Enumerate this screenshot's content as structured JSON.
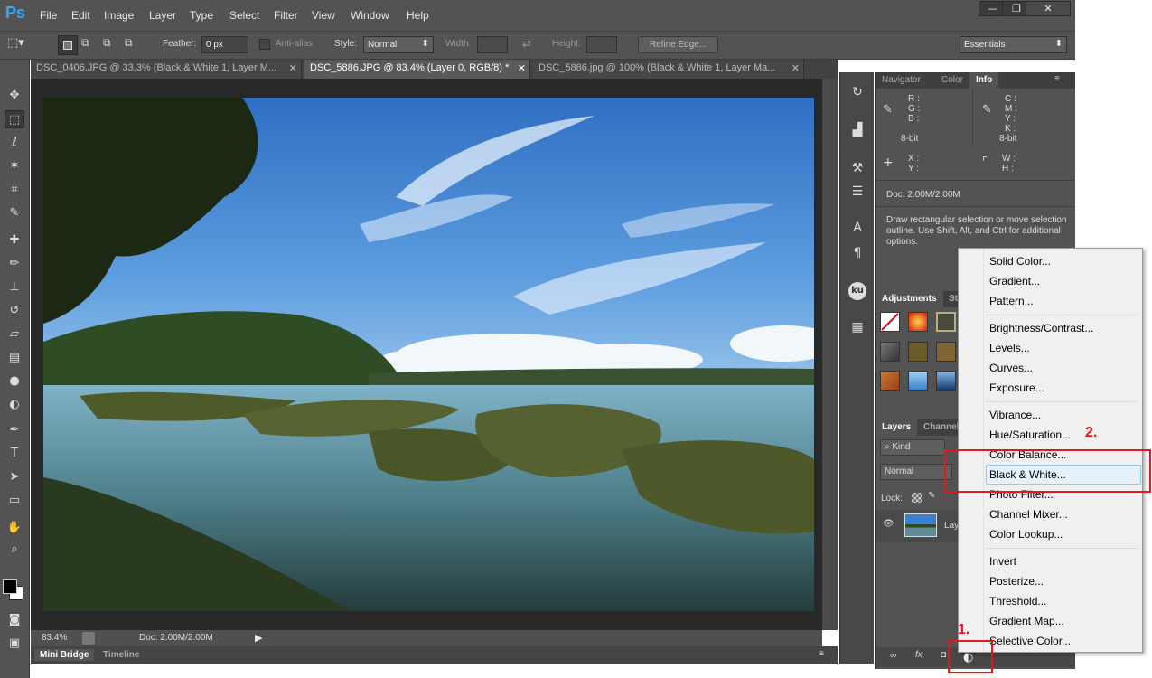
{
  "app": {
    "logo": "Ps"
  },
  "menubar": {
    "items": [
      "File",
      "Edit",
      "Image",
      "Layer",
      "Type",
      "Select",
      "Filter",
      "View",
      "Window",
      "Help"
    ]
  },
  "window_controls": {
    "minimize": "—",
    "restore": "❐",
    "close": "✕"
  },
  "options": {
    "feather_label": "Feather:",
    "feather_value": "0 px",
    "antialias_label": "Anti-alias",
    "style_label": "Style:",
    "style_value": "Normal",
    "width_label": "Width:",
    "height_label": "Height:",
    "refine_edge": "Refine Edge...",
    "workspace": "Essentials"
  },
  "tabs": [
    {
      "label": "DSC_0406.JPG @ 33.3% (Black & White 1, Layer M..."
    },
    {
      "label": "DSC_5886.JPG @ 83.4% (Layer 0, RGB/8) *"
    },
    {
      "label": "DSC_5886.jpg @ 100% (Black & White 1, Layer Ma..."
    }
  ],
  "status": {
    "zoom": "83.4%",
    "doc": "Doc: 2.00M/2.00M"
  },
  "bottom_tabs": [
    "Mini Bridge",
    "Timeline"
  ],
  "info_panel": {
    "tabs": [
      "Navigator",
      "Color",
      "Info"
    ],
    "rgb_labels": "R :\nG :\nB :",
    "cmyk_labels": "C :\nM :\nY :\nK :",
    "bitdepth_left": "8-bit",
    "bitdepth_right": "8-bit",
    "xy_labels": "X :\nY :",
    "wh_labels": "W :\nH :",
    "doc": "Doc: 2.00M/2.00M",
    "hint": "Draw rectangular selection or move selection outline.  Use Shift, Alt, and Ctrl for additional options."
  },
  "adjustments_panel": {
    "tabs": [
      "Adjustments",
      "St"
    ]
  },
  "layers_panel": {
    "tabs": [
      "Layers",
      "Channels"
    ],
    "kind": "Kind",
    "blend": "Normal",
    "lock_label": "Lock:",
    "layer_name": "Lay"
  },
  "context_menu": {
    "groups": [
      [
        "Solid Color...",
        "Gradient...",
        "Pattern..."
      ],
      [
        "Brightness/Contrast...",
        "Levels...",
        "Curves...",
        "Exposure..."
      ],
      [
        "Vibrance...",
        "Hue/Saturation...",
        "Color Balance...",
        "Black & White...",
        "Photo Filter...",
        "Channel Mixer...",
        "Color Lookup..."
      ],
      [
        "Invert",
        "Posterize...",
        "Threshold...",
        "Gradient Map...",
        "Selective Color..."
      ]
    ],
    "highlighted": "Black & White..."
  },
  "annotations": {
    "step1": "1.",
    "step2": "2."
  },
  "colors": {
    "accent_red": "#e8171d",
    "ps_blue": "#31a8ff",
    "menu_highlight": "#e5f1fb"
  }
}
